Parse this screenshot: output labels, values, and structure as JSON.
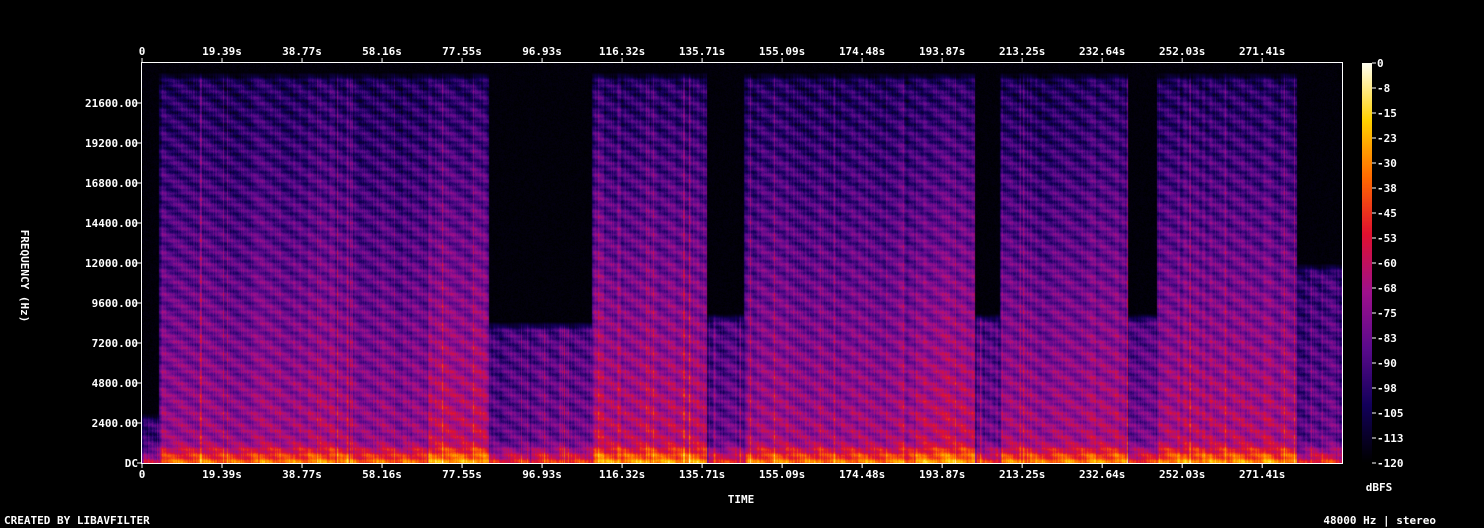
{
  "footer": {
    "credit": "CREATED BY LIBAVFILTER",
    "sample_info": "48000 Hz | stereo"
  },
  "chart_data": {
    "type": "heatmap",
    "title": "",
    "xlabel": "TIME",
    "ylabel": "FREQUENCY (Hz)",
    "colorbar_label": "dBFS",
    "x_ticks": [
      "0",
      "19.39s",
      "38.77s",
      "58.16s",
      "77.55s",
      "96.93s",
      "116.32s",
      "135.71s",
      "155.09s",
      "174.48s",
      "193.87s",
      "213.25s",
      "232.64s",
      "252.03s",
      "271.41s"
    ],
    "y_ticks": [
      "DC",
      "2400.00",
      "4800.00",
      "7200.00",
      "9600.00",
      "12000.00",
      "14400.00",
      "16800.00",
      "19200.00",
      "21600.00"
    ],
    "colorbar_ticks": [
      "0",
      "-8",
      "-15",
      "-23",
      "-30",
      "-38",
      "-45",
      "-53",
      "-60",
      "-68",
      "-75",
      "-83",
      "-90",
      "-98",
      "-105",
      "-113",
      "-120"
    ],
    "xlim": [
      0,
      290.8
    ],
    "ylim": [
      0,
      24000
    ],
    "zlim": [
      -120,
      0
    ],
    "colormap": [
      "#000000",
      "#12005a",
      "#5a0a8c",
      "#a0108c",
      "#e01030",
      "#ff6a00",
      "#ffd200",
      "#fffff0"
    ],
    "segments": [
      {
        "start": 0,
        "end": 4,
        "level": 0.35,
        "cutoff": 3000
      },
      {
        "start": 4,
        "end": 28,
        "level": 0.68,
        "cutoff": 23500
      },
      {
        "start": 28,
        "end": 50,
        "level": 0.72,
        "cutoff": 23500
      },
      {
        "start": 50,
        "end": 69,
        "level": 0.66,
        "cutoff": 23500
      },
      {
        "start": 69,
        "end": 84,
        "level": 0.82,
        "cutoff": 23500
      },
      {
        "start": 84,
        "end": 94,
        "level": 0.5,
        "cutoff": 8500
      },
      {
        "start": 94,
        "end": 109,
        "level": 0.55,
        "cutoff": 8500
      },
      {
        "start": 109,
        "end": 137,
        "level": 0.8,
        "cutoff": 23500
      },
      {
        "start": 137,
        "end": 146,
        "level": 0.5,
        "cutoff": 9000
      },
      {
        "start": 146,
        "end": 187,
        "level": 0.72,
        "cutoff": 23500
      },
      {
        "start": 187,
        "end": 202,
        "level": 0.82,
        "cutoff": 23500
      },
      {
        "start": 202,
        "end": 208,
        "level": 0.55,
        "cutoff": 9000
      },
      {
        "start": 208,
        "end": 239,
        "level": 0.74,
        "cutoff": 23500
      },
      {
        "start": 239,
        "end": 246,
        "level": 0.55,
        "cutoff": 9000
      },
      {
        "start": 246,
        "end": 280,
        "level": 0.78,
        "cutoff": 23500
      },
      {
        "start": 280,
        "end": 290.8,
        "level": 0.5,
        "cutoff": 12000
      }
    ],
    "grid": false,
    "legend": "colorbar-right"
  }
}
